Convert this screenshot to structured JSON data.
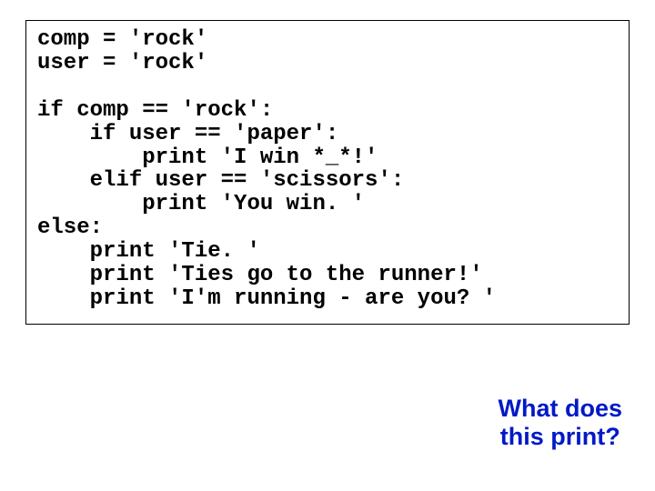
{
  "code": {
    "l1": "comp = 'rock'",
    "l2": "user = 'rock'",
    "l3": "",
    "l4": "if comp == 'rock':",
    "l5": "    if user == 'paper':",
    "l6": "        print 'I win *_*!'",
    "l7": "    elif user == 'scissors':",
    "l8": "        print 'You win. '",
    "l9": "else:",
    "l10": "    print 'Tie. '",
    "l11": "    print 'Ties go to the runner!'",
    "l12": "    print 'I'm running - are you? '"
  },
  "question": {
    "line1": "What does",
    "line2": "this print?"
  }
}
